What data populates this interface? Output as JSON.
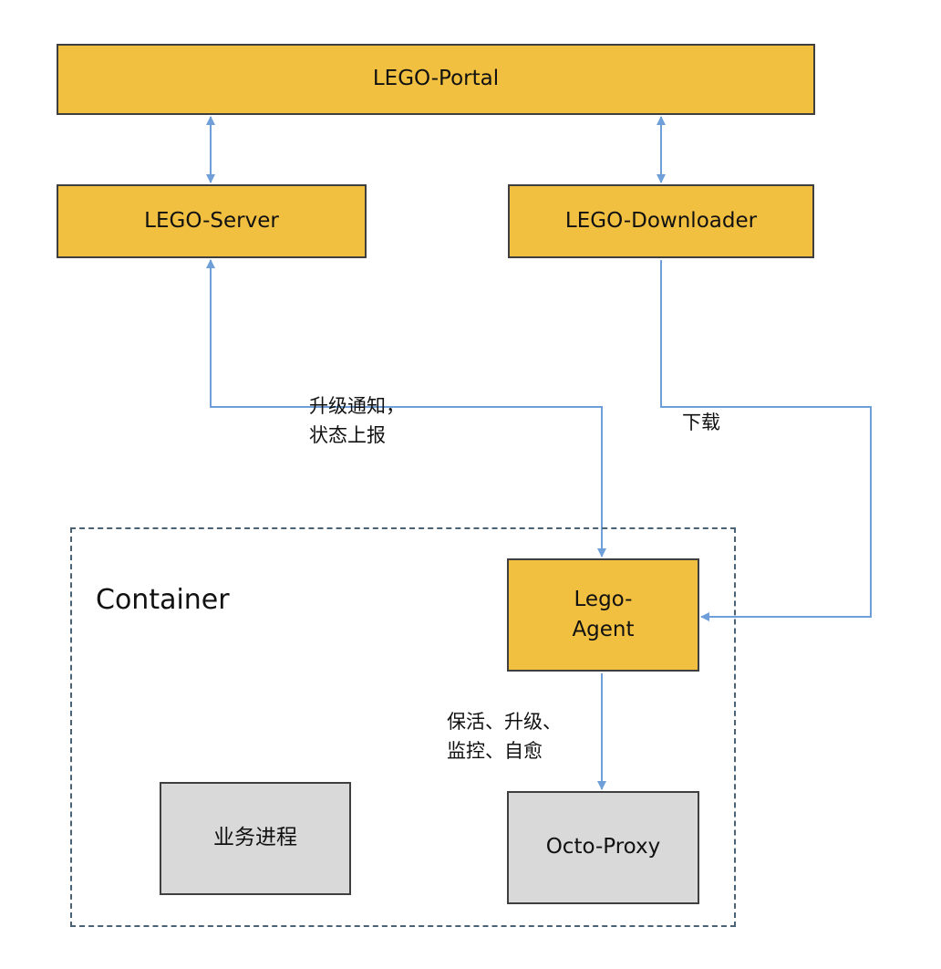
{
  "colors": {
    "node_fill": "#f1c040",
    "process_fill": "#d9d9d9",
    "arrow": "#6e9fd8",
    "container_border": "#4a6275"
  },
  "nodes": {
    "portal": "LEGO-Portal",
    "server": "LEGO-Server",
    "downloader": "LEGO-Downloader",
    "agent": "Lego-\nAgent",
    "process": "业务进程",
    "proxy": "Octo-Proxy"
  },
  "container": {
    "label": "Container"
  },
  "edges": {
    "notify_report": "升级通知，\n状态上报",
    "download": "下载",
    "keepalive": "保活、升级、\n监控、自愈"
  }
}
